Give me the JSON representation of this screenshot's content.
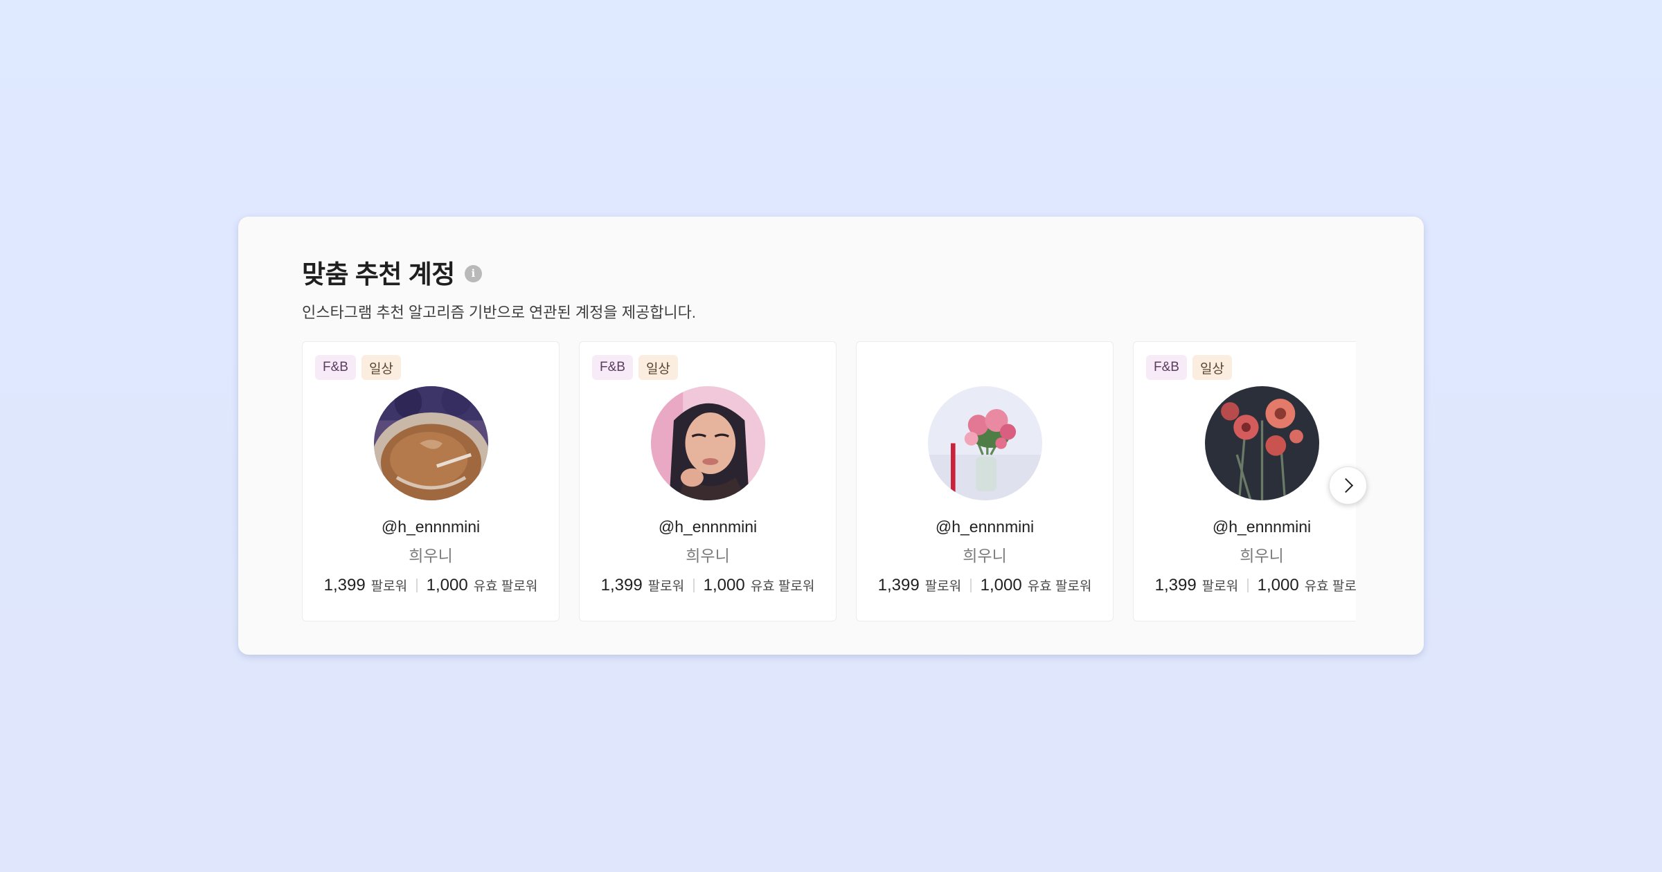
{
  "section": {
    "title": "맞춤 추천 계정",
    "info_icon": "info-icon",
    "subtitle": "인스타그램 추천 알고리즘 기반으로 연관된 계정을 제공합니다."
  },
  "cards": [
    {
      "tags": [
        "F&B",
        "일상"
      ],
      "avatar": "coffee-cup-photo",
      "handle": "@h_ennnmini",
      "name": "희우니",
      "followers": "1,399",
      "followers_label": "팔로워",
      "valid_followers": "1,000",
      "valid_followers_label": "유효 팔로워"
    },
    {
      "tags": [
        "F&B",
        "일상"
      ],
      "avatar": "portrait-photo",
      "handle": "@h_ennnmini",
      "name": "희우니",
      "followers": "1,399",
      "followers_label": "팔로워",
      "valid_followers": "1,000",
      "valid_followers_label": "유효 팔로워"
    },
    {
      "tags": [],
      "avatar": "flower-vase-photo",
      "handle": "@h_ennnmini",
      "name": "희우니",
      "followers": "1,399",
      "followers_label": "팔로워",
      "valid_followers": "1,000",
      "valid_followers_label": "유효 팔로워"
    },
    {
      "tags": [
        "F&B",
        "일상"
      ],
      "avatar": "dark-flowers-photo",
      "handle": "@h_ennnmini",
      "name": "희우니",
      "followers": "1,399",
      "followers_label": "팔로워",
      "valid_followers": "1,000",
      "valid_followers_label": "유효 팔로워"
    }
  ],
  "next_button": {
    "icon": "chevron-right-icon"
  },
  "colors": {
    "background": "#dfe8fe",
    "panel": "#fafafa",
    "tag_fnb_bg": "#f7ebf8",
    "tag_daily_bg": "#fbeee0"
  }
}
